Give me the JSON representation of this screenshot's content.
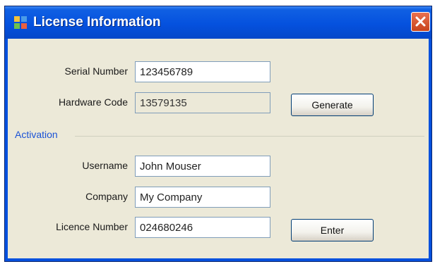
{
  "window": {
    "title": "License Information",
    "close_symbol": "×"
  },
  "license": {
    "serial_label": "Serial Number",
    "serial_value": "123456789",
    "hardware_label": "Hardware Code",
    "hardware_value": "13579135",
    "generate_label": "Generate"
  },
  "activation": {
    "group_label": "Activation",
    "username_label": "Username",
    "username_value": "John Mouser",
    "company_label": "Company",
    "company_value": "My Company",
    "licence_label": "Licence Number",
    "licence_value": "024680246",
    "enter_label": "Enter"
  },
  "colors": {
    "titlebar": "#0551de",
    "close_button": "#d9552d",
    "group_label": "#1a52d6",
    "dialog_background": "#ece9d8"
  },
  "icons": {
    "app": "app-window-icon",
    "close": "close-icon"
  }
}
